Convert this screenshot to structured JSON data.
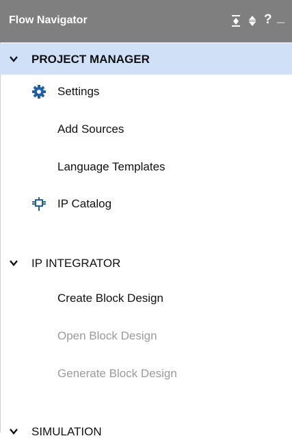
{
  "panel": {
    "title": "Flow Navigator",
    "toolbar": [
      {
        "name": "collapse-all-icon"
      },
      {
        "name": "expand-collapse-icon"
      },
      {
        "name": "help-icon",
        "label": "?"
      },
      {
        "name": "minimize-icon",
        "label": "_"
      }
    ]
  },
  "sections": [
    {
      "label": "PROJECT MANAGER",
      "expanded": true,
      "selected": true,
      "items": [
        {
          "label": "Settings",
          "icon": "gear-icon",
          "enabled": true
        },
        {
          "label": "Add Sources",
          "icon": null,
          "enabled": true
        },
        {
          "label": "Language Templates",
          "icon": null,
          "enabled": true
        },
        {
          "label": "IP Catalog",
          "icon": "ip-plug-icon",
          "enabled": true
        }
      ]
    },
    {
      "label": "IP INTEGRATOR",
      "expanded": true,
      "selected": false,
      "items": [
        {
          "label": "Create Block Design",
          "enabled": true
        },
        {
          "label": "Open Block Design",
          "enabled": false
        },
        {
          "label": "Generate Block Design",
          "enabled": false
        }
      ]
    },
    {
      "label": "SIMULATION",
      "expanded": true,
      "selected": false,
      "items": []
    }
  ],
  "colors": {
    "titlebar": "#7f7f7f",
    "selected_section": "#cfe0f7",
    "icon_blue": "#1f5fa8",
    "disabled_text": "#9b9b9b"
  }
}
